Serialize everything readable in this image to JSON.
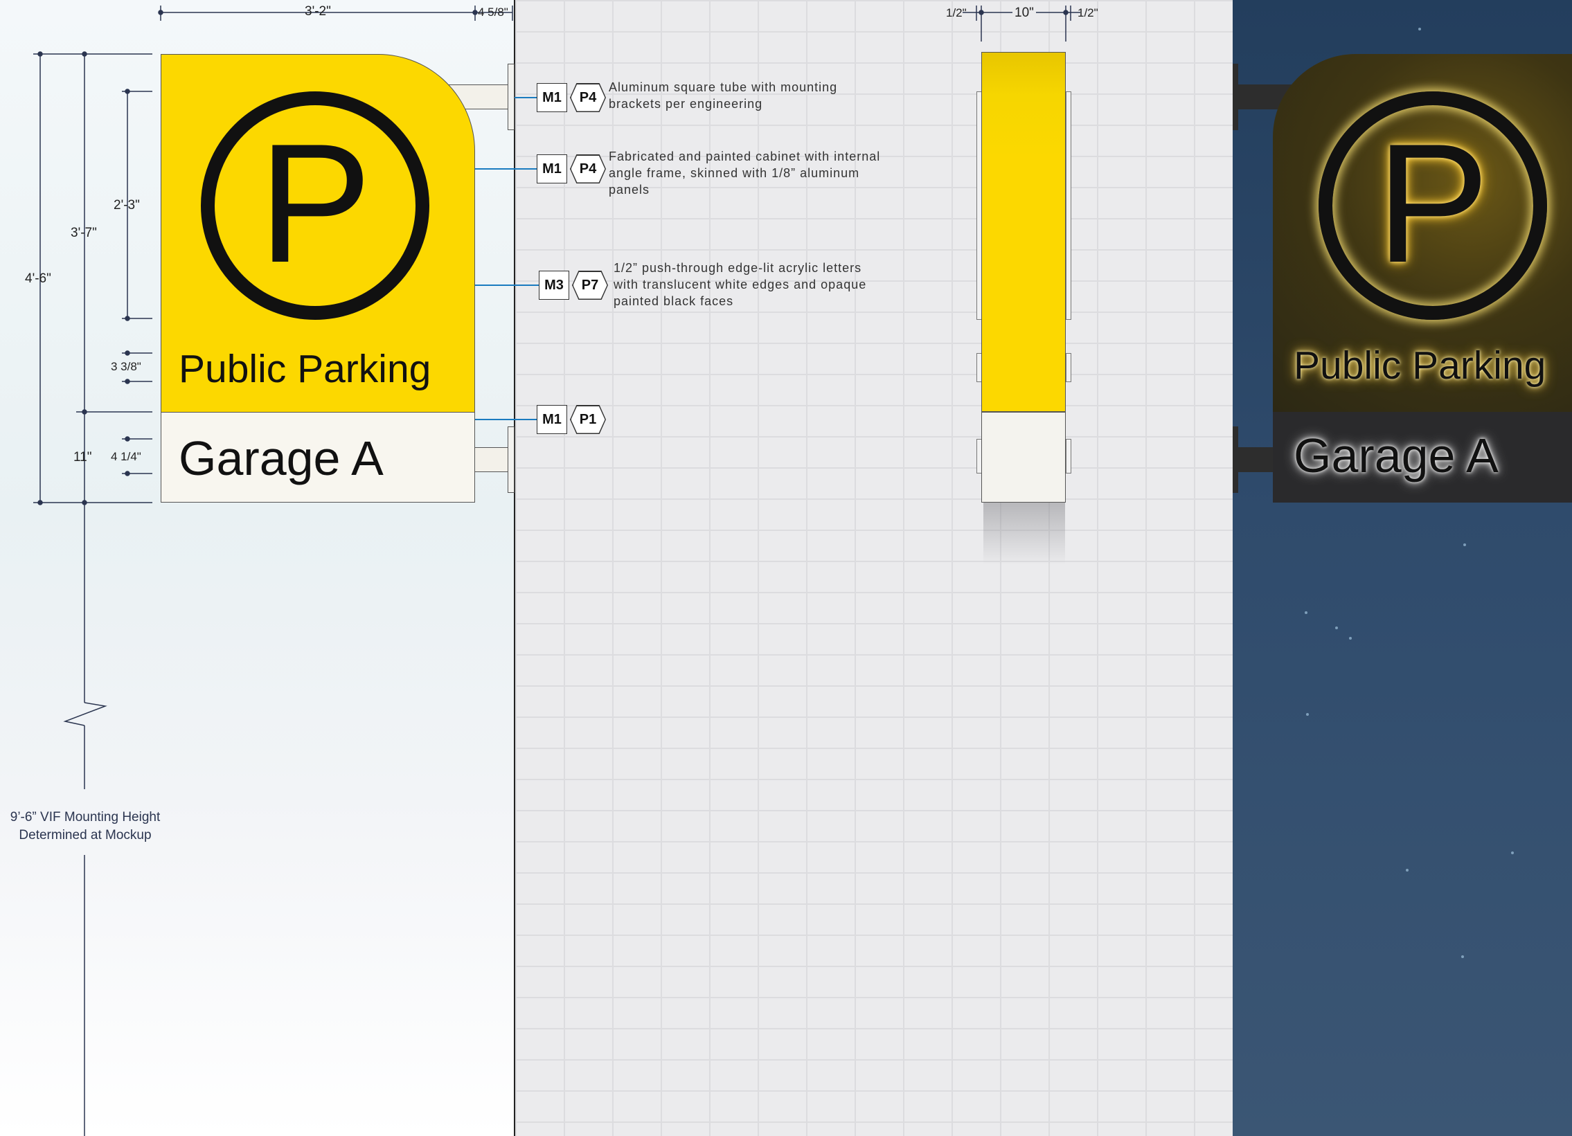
{
  "front_view": {
    "top_line": "Public Parking",
    "bottom_line": "Garage A",
    "symbol": "P",
    "colors": {
      "yellow": "#fcd800",
      "white_panel": "#f8f6ef",
      "black": "#111111"
    }
  },
  "dimensions": {
    "width": "3'-2\"",
    "depth": "4 5/8\"",
    "overall_height": "4'-6\"",
    "yellow_height": "3'-7\"",
    "symbol_height": "2'-3\"",
    "cap_height_top": "3 3/8\"",
    "white_panel_height": "11\"",
    "cap_height_bottom": "4 1/4\"",
    "side_left": "1/2\"",
    "side_width": "10\"",
    "side_right": "1/2\""
  },
  "mounting_note": {
    "line1": "9’-6” VIF Mounting Height",
    "line2": "Determined at Mockup"
  },
  "callouts": [
    {
      "material": "M1",
      "paint": "P4",
      "text": "Aluminum square tube with mounting brackets per engineering"
    },
    {
      "material": "M1",
      "paint": "P4",
      "text": "Fabricated and painted cabinet with internal angle frame, skinned with 1/8” aluminum panels"
    },
    {
      "material": "M3",
      "paint": "P7",
      "text": "1/2” push-through edge-lit acrylic letters with translucent white edges and opaque painted black faces"
    },
    {
      "material": "M1",
      "paint": "P1",
      "text": ""
    }
  ],
  "illuminated_view": {
    "top_line": "Public Parking",
    "bottom_line": "Garage A",
    "symbol": "P",
    "colors": {
      "night_sky": "#2f4b6c",
      "glow": "#ffe27a",
      "cabinet": "#2a2a2c"
    }
  },
  "accent_color": "#1a7bbf"
}
